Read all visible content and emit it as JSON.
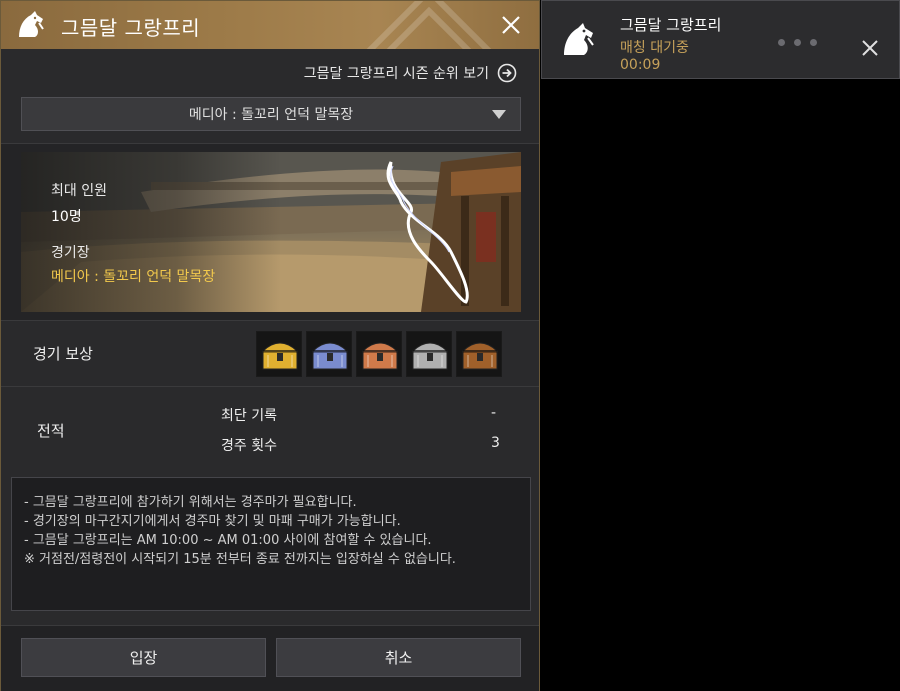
{
  "header": {
    "title": "그믐달 그랑프리"
  },
  "ranking_link": "그믐달 그랑프리 시즌 순위 보기",
  "dropdown": {
    "selected": "메디아 : 돌꼬리 언덕 말목장"
  },
  "arena_info": {
    "max_players_label": "최대 인원",
    "max_players_value": "10명",
    "arena_label": "경기장",
    "arena_value": "메디아 : 돌꼬리 언덕 말목장"
  },
  "rewards": {
    "label": "경기 보상",
    "chests": [
      {
        "icon": "gold-chest-icon",
        "color": "#e0b030"
      },
      {
        "icon": "blue-chest-icon",
        "color": "#7a8ccf"
      },
      {
        "icon": "bronze-chest-icon",
        "color": "#d07a4a"
      },
      {
        "icon": "silver-chest-icon",
        "color": "#b0b0b0"
      },
      {
        "icon": "wooden-chest-icon",
        "color": "#a0602a"
      }
    ]
  },
  "record": {
    "label": "전적",
    "best_time_label": "최단 기록",
    "best_time_value": "-",
    "race_count_label": "경주 횟수",
    "race_count_value": "3"
  },
  "notice": [
    "- 그믐달 그랑프리에 참가하기 위해서는 경주마가 필요합니다.",
    "- 경기장의 마구간지기에게서 경주마 찾기 및 마패 구매가 가능합니다.",
    "- 그믐달 그랑프리는 AM 10:00 ~ AM 01:00 사이에 참여할 수 있습니다.",
    "※ 거점전/점령전이 시작되기 15분 전부터 종료 전까지는 입장하실 수 없습니다."
  ],
  "buttons": {
    "enter": "입장",
    "cancel": "취소"
  },
  "notification": {
    "title": "그믐달 그랑프리",
    "status": "매칭 대기중",
    "timer": "00:09"
  },
  "colors": {
    "accent_gold": "#f2c94c",
    "header_bronze": "#9c7a48",
    "status_gold": "#c6a15a"
  }
}
